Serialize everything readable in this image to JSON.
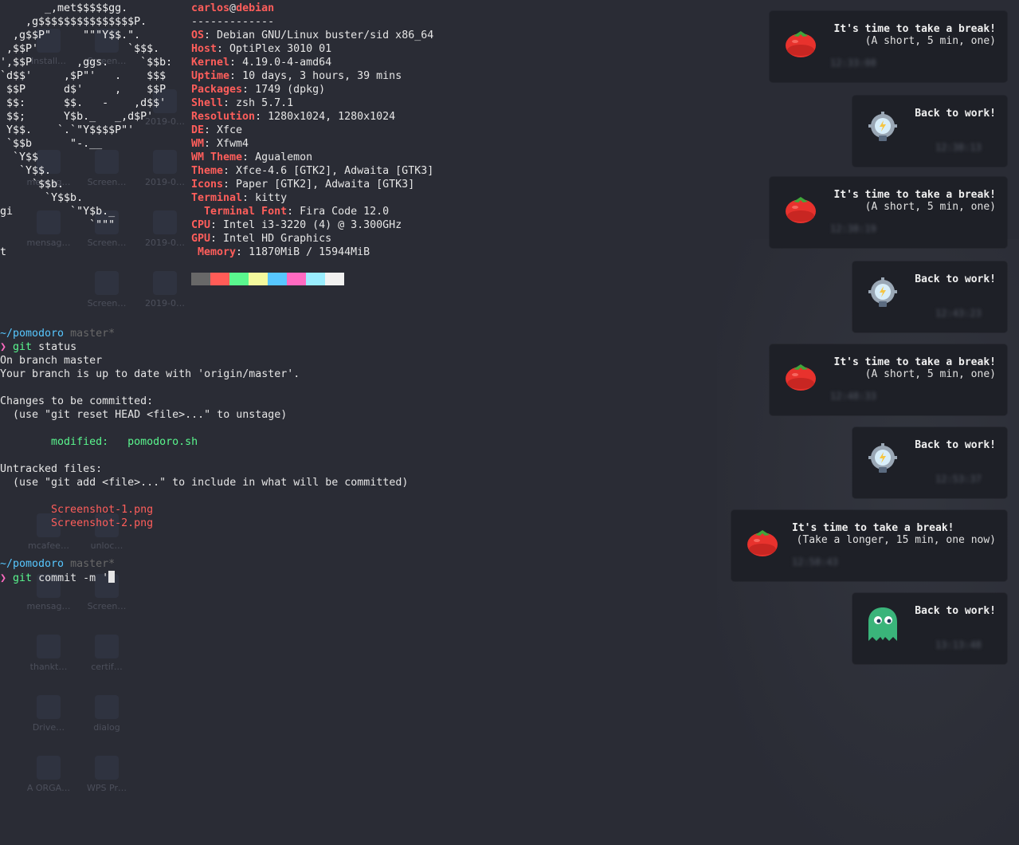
{
  "colors": {
    "background": "#2a2c35",
    "accent_red": "#ff5e5b",
    "path_blue": "#57c7ff",
    "prompt_magenta": "#ff6ac1",
    "added_green": "#5af78e",
    "notification_bg": "#1e2027"
  },
  "desktop_icons": [
    {
      "label": "Install…",
      "icon": "file-icon"
    },
    {
      "label": "Screen…",
      "icon": "image-icon"
    },
    {
      "label": "2019-0…",
      "icon": "document-icon"
    },
    {
      "label": "mensag…",
      "icon": "file-icon"
    },
    {
      "label": "Screen…",
      "icon": "image-icon"
    },
    {
      "label": "2019-0…",
      "icon": "document-icon"
    },
    {
      "label": "mensag…",
      "icon": "file-icon"
    },
    {
      "label": "Screen…",
      "icon": "image-icon"
    },
    {
      "label": "2019-0…",
      "icon": "document-icon"
    },
    {
      "label": "Screen…",
      "icon": "image-icon"
    },
    {
      "label": "2019-0…",
      "icon": "document-icon"
    },
    {
      "label": "mcafee…",
      "icon": "file-icon"
    },
    {
      "label": "unloc…",
      "icon": "file-icon"
    },
    {
      "label": "mensag…",
      "icon": "file-icon"
    },
    {
      "label": "Screen…",
      "icon": "image-icon"
    },
    {
      "label": "thankt…",
      "icon": "file-icon"
    },
    {
      "label": "certif…",
      "icon": "folder-icon"
    },
    {
      "label": "Drive…",
      "icon": "file-icon"
    },
    {
      "label": "dialog",
      "icon": "folder-icon"
    },
    {
      "label": "A ORGA…",
      "icon": "video-icon"
    },
    {
      "label": "WPS Pr…",
      "icon": "presentation-icon"
    }
  ],
  "terminal": {
    "ascii_art": [
      "       _,met$$$$$gg.",
      "    ,g$$$$$$$$$$$$$$$P.",
      "  ,g$$P\"     \"\"\"Y$$.\".",
      " ,$$P'              `$$$.",
      "',$$P       ,ggs.     `$$b:",
      "`d$$'     ,$P\"'   .    $$$",
      " $$P      d$'     ,    $$P",
      " $$:      $$.   -    ,d$$'",
      " $$;      Y$b._   _,d$P'",
      " Y$$.    `.`\"Y$$$$P\"'",
      " `$$b      \"-.__",
      "  `Y$$",
      "   `Y$$.",
      "     `$$b.",
      "       `Y$$b.",
      "gi         `\"Y$b._",
      "              `\"\"\"",
      "t"
    ],
    "user": "carlos",
    "at": "@",
    "host": "debian",
    "separator": "-------------",
    "info": [
      {
        "key": "OS",
        "value": "Debian GNU/Linux buster/sid x86_64"
      },
      {
        "key": "Host",
        "value": "OptiPlex 3010 01"
      },
      {
        "key": "Kernel",
        "value": "4.19.0-4-amd64"
      },
      {
        "key": "Uptime",
        "value": "10 days, 3 hours, 39 mins"
      },
      {
        "key": "Packages",
        "value": "1749 (dpkg)"
      },
      {
        "key": "Shell",
        "value": "zsh 5.7.1"
      },
      {
        "key": "Resolution",
        "value": "1280x1024, 1280x1024"
      },
      {
        "key": "DE",
        "value": "Xfce"
      },
      {
        "key": "WM",
        "value": "Xfwm4"
      },
      {
        "key": "WM Theme",
        "value": "Agualemon"
      },
      {
        "key": "Theme",
        "value": "Xfce-4.6 [GTK2], Adwaita [GTK3]"
      },
      {
        "key": "Icons",
        "value": "Paper [GTK2], Adwaita [GTK3]"
      },
      {
        "key": "Terminal",
        "value": "kitty"
      },
      {
        "key": "  Terminal Font",
        "value": "Fira Code 12.0"
      },
      {
        "key": "CPU",
        "value": "Intel i3-3220 (4) @ 3.300GHz"
      },
      {
        "key": "GPU",
        "value": "Intel HD Graphics"
      },
      {
        "key": " Memory",
        "value": "11870MiB / 15944MiB"
      }
    ],
    "palette": [
      "#686868",
      "#ff5c57",
      "#5af78e",
      "#f3f99d",
      "#57c7ff",
      "#ff6ac1",
      "#9aedfe",
      "#f1f1f0"
    ],
    "prompt1": {
      "path": "~/pomodoro",
      "branch": "master*",
      "symbol": "❯",
      "cmd": "git",
      "args": " status"
    },
    "git_output": {
      "l1": "On branch master",
      "l2": "Your branch is up to date with 'origin/master'.",
      "l3": "Changes to be committed:",
      "l4": "  (use \"git reset HEAD <file>...\" to unstage)",
      "modified_label": "        modified:   ",
      "modified_file": "pomodoro.sh",
      "l5": "Untracked files:",
      "l6": "  (use \"git add <file>...\" to include in what will be committed)",
      "untracked": [
        "        Screenshot-1.png",
        "        Screenshot-2.png"
      ]
    },
    "prompt2": {
      "path": "~/pomodoro",
      "branch": "master*",
      "symbol": "❯",
      "cmd": "git",
      "args": " commit -m '"
    }
  },
  "notifications": [
    {
      "icon": "tomato-icon",
      "title": "It's time to take a break!",
      "body": "(A short, 5 min, one)",
      "time": "12:33:08"
    },
    {
      "icon": "lightbulb-gear-icon",
      "title": "Back to work!",
      "body": "",
      "time": "12:38:13"
    },
    {
      "icon": "tomato-icon",
      "title": "It's time to take a break!",
      "body": "(A short, 5 min, one)",
      "time": "12:38:19"
    },
    {
      "icon": "lightbulb-gear-icon",
      "title": "Back to work!",
      "body": "",
      "time": "12:43:23"
    },
    {
      "icon": "tomato-icon",
      "title": "It's time to take a break!",
      "body": "(A short, 5 min, one)",
      "time": "12:48:33"
    },
    {
      "icon": "lightbulb-gear-icon",
      "title": "Back to work!",
      "body": "",
      "time": "12:53:37"
    },
    {
      "icon": "tomato-icon",
      "title": "It's time to take a break!",
      "body": "(Take a longer, 15 min, one now)",
      "time": "12:58:43"
    },
    {
      "icon": "ghost-icon",
      "title": "Back to work!",
      "body": "",
      "time": "13:13:48"
    }
  ]
}
